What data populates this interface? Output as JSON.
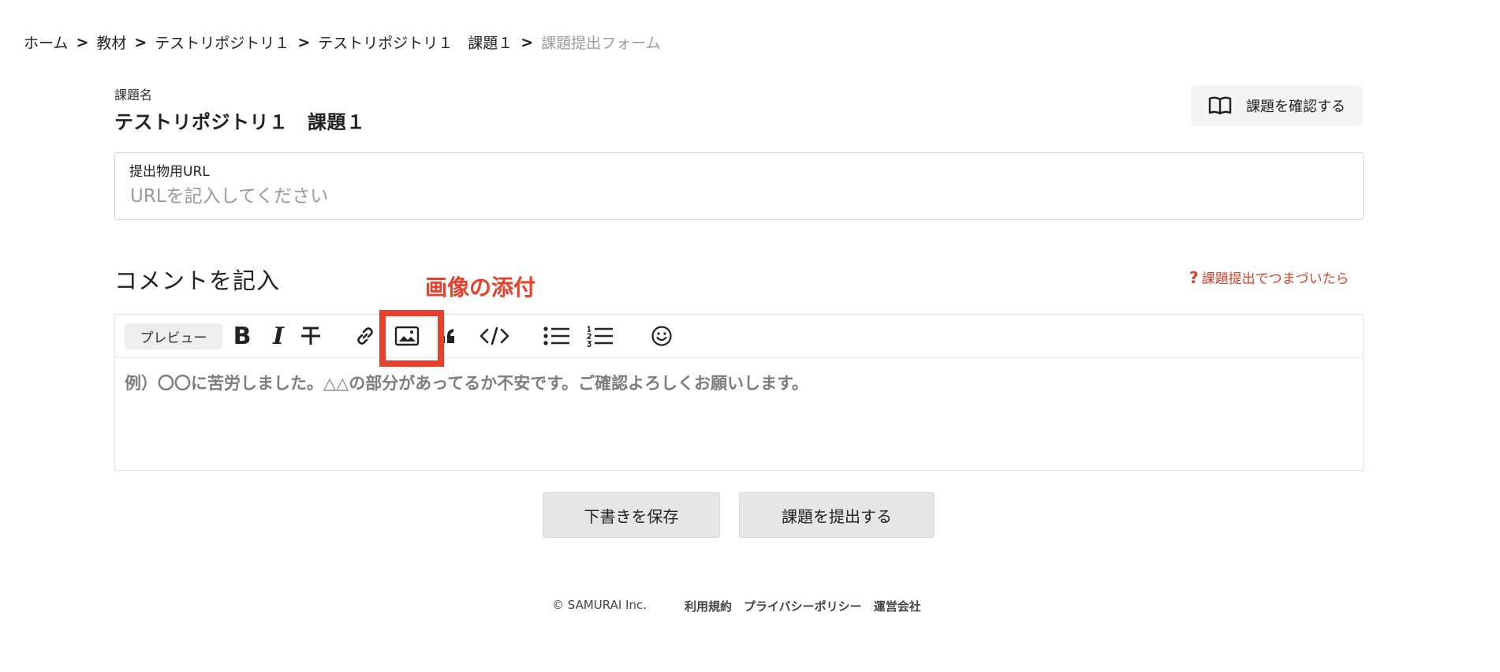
{
  "breadcrumb": {
    "items": [
      "ホーム",
      "教材",
      "テストリポジトリ１",
      "テストリポジトリ１　課題１"
    ],
    "current": "課題提出フォーム",
    "separator": ">"
  },
  "assignment": {
    "label": "課題名",
    "title": "テストリポジトリ１　課題１",
    "confirm_button": "課題を確認する"
  },
  "url_field": {
    "label": "提出物用URL",
    "placeholder": "URLを記入してください",
    "value": ""
  },
  "comment": {
    "heading": "コメントを記入",
    "help_link": "課題提出でつまづいたら",
    "placeholder": "例）〇〇に苦労しました。△△の部分があってるか不安です。ご確認よろしくお願いします。",
    "value": ""
  },
  "toolbar": {
    "preview": "プレビュー",
    "bold_glyph": "B",
    "italic_glyph": "I",
    "icons": [
      "bold-icon",
      "italic-icon",
      "strikethrough-icon",
      "link-icon",
      "image-icon",
      "quote-icon",
      "code-icon",
      "bullet-list-icon",
      "numbered-list-icon",
      "emoji-icon"
    ]
  },
  "annotation": {
    "text": "画像の添付",
    "color": "#e8412b"
  },
  "actions": {
    "draft": "下書きを保存",
    "submit": "課題を提出する"
  },
  "footer": {
    "copyright": "© SAMURAI Inc.",
    "links": [
      "利用規約",
      "プライバシーポリシー",
      "運営会社"
    ]
  },
  "colors": {
    "accent_red": "#e0402a",
    "button_bg": "#e6e6e6",
    "muted_text": "#9c9c9c"
  }
}
